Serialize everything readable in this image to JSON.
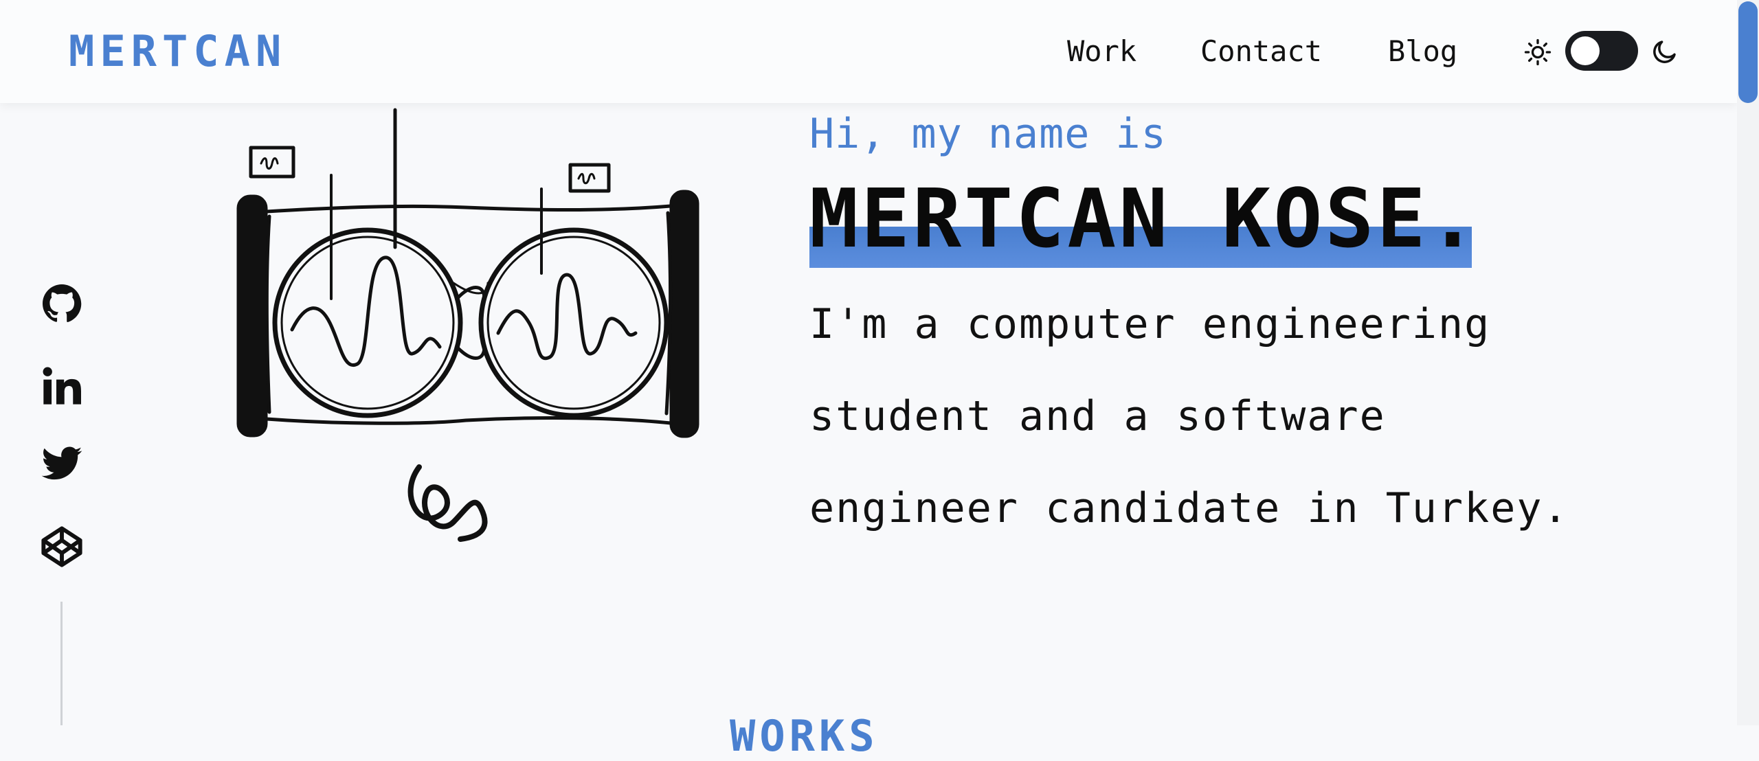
{
  "header": {
    "logo": "MERTCAN",
    "nav": [
      "Work",
      "Contact",
      "Blog"
    ],
    "theme_toggle": {
      "state": "light",
      "light_icon": "sun-icon",
      "dark_icon": "moon-icon"
    }
  },
  "social": [
    "github-icon",
    "linkedin-icon",
    "twitter-icon",
    "codepen-icon"
  ],
  "hero": {
    "greeting": "Hi, my name is",
    "name": "MERTCAN KOSE.",
    "bio_lines": [
      "I'm a computer engineering",
      "student and a software",
      "engineer candidate in Turkey."
    ]
  },
  "sections": {
    "works_title": "WORKS"
  },
  "colors": {
    "accent": "#4a80d0",
    "background": "#f8f9fb",
    "text": "#111111"
  }
}
